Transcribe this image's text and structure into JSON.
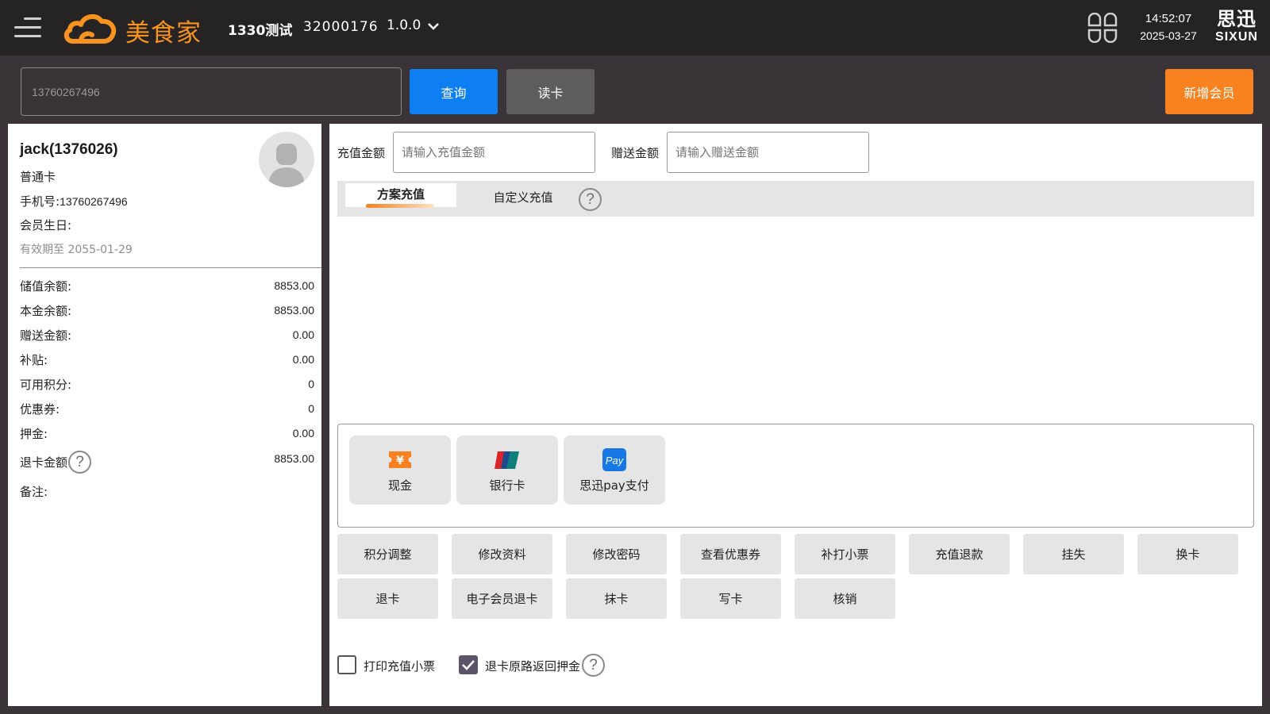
{
  "header": {
    "logo_text": "美食家",
    "store_name": "1330测试",
    "store_id": "32000176",
    "version": "1.0.0",
    "time": "14:52:07",
    "date": "2025-03-27",
    "brand_cn": "思迅",
    "brand_en": "SIXUN"
  },
  "search": {
    "value": "13760267496",
    "query_label": "查询",
    "read_card_label": "读卡",
    "add_member_label": "新增会员"
  },
  "member": {
    "name": "jack(1376026)",
    "card_type": "普通卡",
    "phone_label": "手机号:",
    "phone": "13760267496",
    "birthday_label": "会员生日:",
    "expiry": "有效期至 2055-01-29",
    "stats": [
      {
        "label": "储值余额:",
        "value": "8853.00"
      },
      {
        "label": "本金余额:",
        "value": "8853.00"
      },
      {
        "label": "赠送金额:",
        "value": "0.00"
      },
      {
        "label": "补贴:",
        "value": "0.00"
      },
      {
        "label": "可用积分:",
        "value": "0"
      },
      {
        "label": "优惠券:",
        "value": "0"
      },
      {
        "label": "押金:",
        "value": "0.00"
      }
    ],
    "refund_label": "退卡金额",
    "refund_value": "8853.00",
    "remark_label": "备注:"
  },
  "recharge": {
    "amount_label": "充值金额",
    "amount_placeholder": "请输入充值金额",
    "gift_label": "赠送金额",
    "gift_placeholder": "请输入赠送金额",
    "tabs": [
      "方案充值",
      "自定义充值"
    ],
    "help_glyph": "?"
  },
  "payments": [
    {
      "label": "现金",
      "icon": "cash-icon"
    },
    {
      "label": "银行卡",
      "icon": "unionpay-icon"
    },
    {
      "label": "思迅pay支付",
      "icon": "sixun-pay-icon"
    }
  ],
  "actions": [
    "积分调整",
    "修改资料",
    "修改密码",
    "查看优惠券",
    "补打小票",
    "充值退款",
    "挂失",
    "换卡",
    "退卡",
    "电子会员退卡",
    "抹卡",
    "写卡",
    "核销"
  ],
  "options": {
    "print_receipt_label": "打印充值小票",
    "print_receipt_checked": false,
    "refund_deposit_label": "退卡原路返回押金",
    "refund_deposit_checked": true
  },
  "colors": {
    "accent_orange": "#f7821f",
    "accent_blue": "#0d7ff2",
    "topbar": "#262325",
    "background": "#3a3337"
  }
}
